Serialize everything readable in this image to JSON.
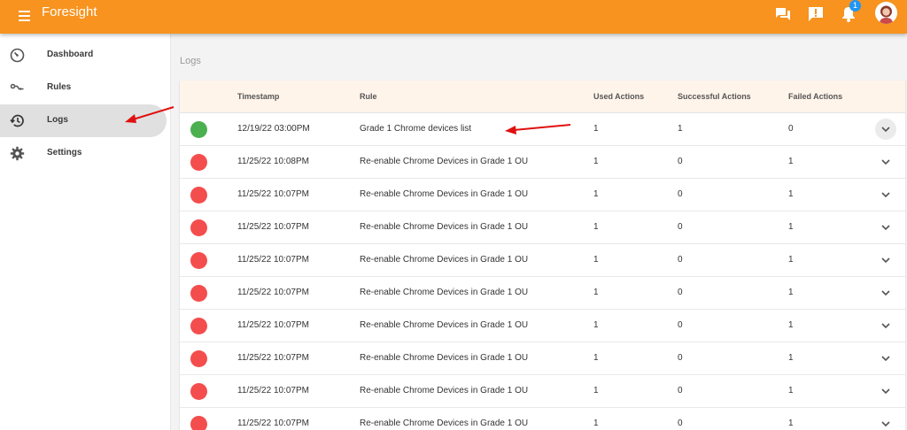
{
  "app": {
    "title": "Foresight"
  },
  "header": {
    "notification_count": "1"
  },
  "sidebar": {
    "items": [
      {
        "label": "Dashboard",
        "icon": "speedometer-icon"
      },
      {
        "label": "Rules",
        "icon": "rule-icon"
      },
      {
        "label": "Logs",
        "icon": "history-icon",
        "active": true
      },
      {
        "label": "Settings",
        "icon": "gear-icon"
      }
    ]
  },
  "page": {
    "title": "Logs"
  },
  "table": {
    "columns": [
      "Timestamp",
      "Rule",
      "Used Actions",
      "Successful Actions",
      "Failed Actions"
    ],
    "rows": [
      {
        "status": "success",
        "timestamp": "12/19/22 03:00PM",
        "rule": "Grade 1 Chrome devices list",
        "used": "1",
        "successful": "1",
        "failed": "0"
      },
      {
        "status": "failed",
        "timestamp": "11/25/22 10:08PM",
        "rule": "Re-enable Chrome Devices in Grade 1 OU",
        "used": "1",
        "successful": "0",
        "failed": "1"
      },
      {
        "status": "failed",
        "timestamp": "11/25/22 10:07PM",
        "rule": "Re-enable Chrome Devices in Grade 1 OU",
        "used": "1",
        "successful": "0",
        "failed": "1"
      },
      {
        "status": "failed",
        "timestamp": "11/25/22 10:07PM",
        "rule": "Re-enable Chrome Devices in Grade 1 OU",
        "used": "1",
        "successful": "0",
        "failed": "1"
      },
      {
        "status": "failed",
        "timestamp": "11/25/22 10:07PM",
        "rule": "Re-enable Chrome Devices in Grade 1 OU",
        "used": "1",
        "successful": "0",
        "failed": "1"
      },
      {
        "status": "failed",
        "timestamp": "11/25/22 10:07PM",
        "rule": "Re-enable Chrome Devices in Grade 1 OU",
        "used": "1",
        "successful": "0",
        "failed": "1"
      },
      {
        "status": "failed",
        "timestamp": "11/25/22 10:07PM",
        "rule": "Re-enable Chrome Devices in Grade 1 OU",
        "used": "1",
        "successful": "0",
        "failed": "1"
      },
      {
        "status": "failed",
        "timestamp": "11/25/22 10:07PM",
        "rule": "Re-enable Chrome Devices in Grade 1 OU",
        "used": "1",
        "successful": "0",
        "failed": "1"
      },
      {
        "status": "failed",
        "timestamp": "11/25/22 10:07PM",
        "rule": "Re-enable Chrome Devices in Grade 1 OU",
        "used": "1",
        "successful": "0",
        "failed": "1"
      },
      {
        "status": "failed",
        "timestamp": "11/25/22 10:07PM",
        "rule": "Re-enable Chrome Devices in Grade 1 OU",
        "used": "1",
        "successful": "0",
        "failed": "1"
      }
    ]
  },
  "colors": {
    "accent": "#f7931e",
    "success": "#4caf50",
    "failed": "#f44d4d",
    "badge": "#2196f3",
    "annotation": "#e01010"
  }
}
